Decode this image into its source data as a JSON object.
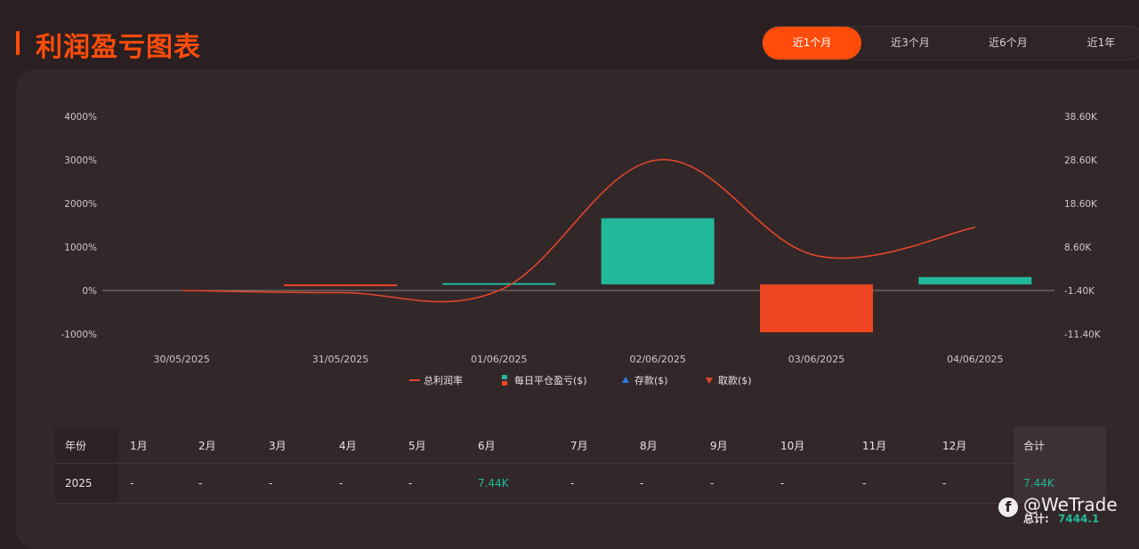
{
  "page": {
    "title": "利润盈亏图表"
  },
  "tabs": [
    "近1个月",
    "近3个月",
    "近6个月",
    "近1年"
  ],
  "active_tab": 0,
  "colors": {
    "accent": "#ff4c0b",
    "profit": "#22b89a",
    "loss": "#ee4622",
    "line": "#e0462a",
    "deposit": "#2e7be6",
    "withdraw": "#e0462a"
  },
  "chart_data": {
    "type": "bar",
    "categories": [
      "30/05/2025",
      "31/05/2025",
      "01/06/2025",
      "02/06/2025",
      "03/06/2025",
      "04/06/2025"
    ],
    "y_left_ticks": [
      "4000%",
      "3000%",
      "2000%",
      "1000%",
      "0%",
      "-1000%"
    ],
    "y_right_ticks": [
      "38.60K",
      "28.60K",
      "18.60K",
      "8.60K",
      "-1.40K",
      "-11.40K"
    ],
    "ylim_left": [
      -1000,
      4000
    ],
    "ylim_right": [
      -11400,
      38600
    ],
    "series": [
      {
        "name": "总利润率",
        "type": "line",
        "axis": "left",
        "values": [
          0,
          -50,
          0,
          3000,
          800,
          1450
        ]
      },
      {
        "name": "每日平仓盈亏($)",
        "type": "bar",
        "axis": "right",
        "values": [
          0,
          -150,
          300,
          15200,
          -11000,
          1700
        ]
      },
      {
        "name": "存款($)",
        "type": "marker",
        "values": []
      },
      {
        "name": "取款($)",
        "type": "marker",
        "values": []
      }
    ],
    "legend_position": "bottom",
    "grid": true
  },
  "table": {
    "headers": [
      "年份",
      "1月",
      "2月",
      "3月",
      "4月",
      "5月",
      "6月",
      "7月",
      "8月",
      "9月",
      "10月",
      "11月",
      "12月",
      "合计"
    ],
    "rows": [
      [
        "2025",
        "-",
        "-",
        "-",
        "-",
        "-",
        "7.44K",
        "-",
        "-",
        "-",
        "-",
        "-",
        "-",
        "7.44K"
      ]
    ]
  },
  "footer": {
    "total_label": "总计:",
    "total_value": "7444.1",
    "watermark": "@WeTrade"
  }
}
